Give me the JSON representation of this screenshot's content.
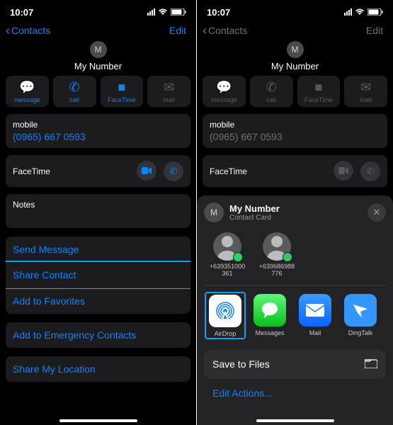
{
  "statusBar": {
    "time": "10:07"
  },
  "left": {
    "nav": {
      "back": "Contacts",
      "edit": "Edit"
    },
    "header": {
      "initial": "M",
      "title": "My Number"
    },
    "actions": {
      "message": "message",
      "call": "call",
      "facetime": "FaceTime",
      "mail": "mail"
    },
    "mobile": {
      "label": "mobile",
      "value": "(0965) 667 0593"
    },
    "facetimeLabel": "FaceTime",
    "notesLabel": "Notes",
    "menu": {
      "sendMessage": "Send Message",
      "shareContact": "Share Contact",
      "addFav": "Add to Favorites",
      "addEmergency": "Add to Emergency Contacts",
      "shareLocation": "Share My Location"
    }
  },
  "right": {
    "nav": {
      "back": "Contacts",
      "edit": "Edit"
    },
    "header": {
      "initial": "M",
      "title": "My Number"
    },
    "actions": {
      "message": "message",
      "call": "call",
      "facetime": "FaceTime",
      "mail": "mail"
    },
    "mobile": {
      "label": "mobile",
      "value": "(0965) 667 0593"
    },
    "facetimeLabel": "FaceTime",
    "sheet": {
      "title": "My Number",
      "subtitle": "Contact Card",
      "contacts": [
        {
          "name": "+639351000361"
        },
        {
          "name": "+639686988776"
        }
      ],
      "apps": {
        "airdrop": "AirDrop",
        "messages": "Messages",
        "mail": "Mail",
        "dingtalk": "DingTalk"
      },
      "saveToFiles": "Save to Files",
      "editActions": "Edit Actions..."
    }
  }
}
